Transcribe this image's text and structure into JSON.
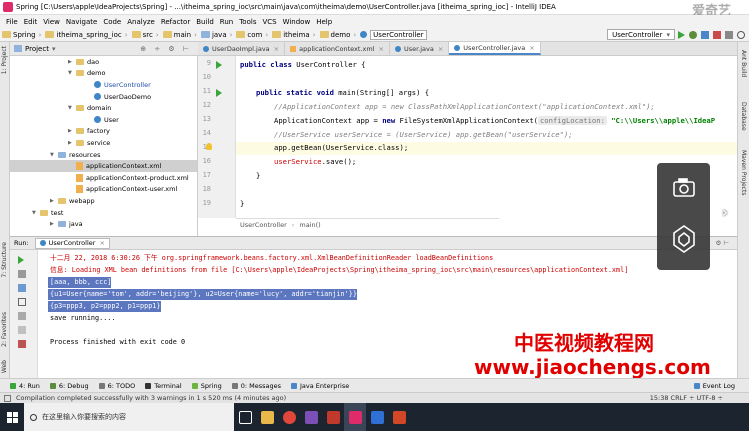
{
  "window_title": "Spring [C:\\Users\\apple\\IdeaProjects\\Spring] - ...\\itheima_spring_ioc\\src\\main\\java\\com\\itheima\\demo\\UserController.java [itheima_spring_ioc] - IntelliJ IDEA",
  "menu": [
    "File",
    "Edit",
    "View",
    "Navigate",
    "Code",
    "Analyze",
    "Refactor",
    "Build",
    "Run",
    "Tools",
    "VCS",
    "Window",
    "Help"
  ],
  "breadcrumbs": [
    "Spring",
    "itheima_spring_ioc",
    "src",
    "main",
    "java",
    "com",
    "itheima",
    "demo",
    "UserController"
  ],
  "run_config": "UserController",
  "project_panel": {
    "title": "Project"
  },
  "tree": [
    {
      "label": "dao",
      "depth": 6,
      "kind": "folder",
      "expanded": false
    },
    {
      "label": "demo",
      "depth": 6,
      "kind": "folder",
      "expanded": true
    },
    {
      "label": "UserController",
      "depth": 8,
      "kind": "class",
      "selected": false
    },
    {
      "label": "UserDaoDemo",
      "depth": 8,
      "kind": "class"
    },
    {
      "label": "domain",
      "depth": 6,
      "kind": "folder",
      "expanded": true
    },
    {
      "label": "User",
      "depth": 8,
      "kind": "class"
    },
    {
      "label": "factory",
      "depth": 6,
      "kind": "folder",
      "expanded": false
    },
    {
      "label": "service",
      "depth": 6,
      "kind": "folder",
      "expanded": false
    },
    {
      "label": "resources",
      "depth": 4,
      "kind": "folder",
      "expanded": true
    },
    {
      "label": "applicationContext.xml",
      "depth": 6,
      "kind": "xml",
      "selected": true
    },
    {
      "label": "applicationContext-product.xml",
      "depth": 6,
      "kind": "xml"
    },
    {
      "label": "applicationContext-user.xml",
      "depth": 6,
      "kind": "xml"
    },
    {
      "label": "webapp",
      "depth": 4,
      "kind": "folder",
      "expanded": false
    },
    {
      "label": "test",
      "depth": 2,
      "kind": "folder",
      "expanded": true
    },
    {
      "label": "java",
      "depth": 4,
      "kind": "folder",
      "expanded": false
    }
  ],
  "tabs": [
    {
      "label": "UserDaoImpl.java",
      "kind": "class",
      "active": false
    },
    {
      "label": "applicationContext.xml",
      "kind": "xml",
      "active": false
    },
    {
      "label": "User.java",
      "kind": "class",
      "active": false
    },
    {
      "label": "UserController.java",
      "kind": "class",
      "active": true
    }
  ],
  "line_numbers": [
    "9",
    "10",
    "11",
    "12",
    "13",
    "14",
    "15",
    "16",
    "17",
    "18",
    "19"
  ],
  "code": {
    "l9_kw": "public class",
    "l9_rest": " UserController {",
    "l11_kw": "public static void",
    "l11_rest": " main(String[] args) {",
    "l12": "//ApplicationContext app = new ClassPathXmlApplicationContext(\"applicationContext.xml\");",
    "l13_a": "ApplicationContext app = ",
    "l13_kw": "new",
    "l13_b": " FileSystemXmlApplicationContext(",
    "l13_hint": "configLocation:",
    "l13_str": " \"C:\\\\Users\\\\apple\\\\IdeaP",
    "l14": "//UserService userService = (UserService) app.getBean(\"userService\");",
    "l15": "app.getBean(UserService.class);",
    "l16_a": "userService",
    "l16_b": ".save();",
    "l17": "}",
    "l19": "}"
  },
  "code_breadcrumb": [
    "UserController",
    "main()"
  ],
  "run_panel": {
    "label": "Run:",
    "tab": "UserController"
  },
  "console": [
    {
      "text": "十二月 22, 2018 6:30:26 下午 org.springframework.beans.factory.xml.XmlBeanDefinitionReader loadBeanDefinitions",
      "style": "err"
    },
    {
      "text": "信息: Loading XML bean definitions from file [C:\\Users\\apple\\IdeaProjects\\Spring\\itheima_spring_ioc\\src\\main\\resources\\applicationContext.xml]",
      "style": "err"
    },
    {
      "text": "[aaa, bbb, ccc]",
      "style": "sel"
    },
    {
      "text": "{u1=User{name='tom', addr='beijing'}, u2=User{name='lucy', addr='tianjin'}}",
      "style": "sel"
    },
    {
      "text": "{p3=ppp3, p2=ppp2, p1=ppp1}",
      "style": "sel"
    },
    {
      "text": "save running....",
      "style": "normal"
    },
    {
      "text": "",
      "style": "normal"
    },
    {
      "text": "Process finished with exit code 0",
      "style": "normal"
    }
  ],
  "bottom_tabs": [
    "4: Run",
    "6: Debug",
    "6: TODO",
    "Terminal",
    "Spring",
    "0: Messages",
    "Java Enterprise"
  ],
  "event_log": "Event Log",
  "status_text": "Compilation completed successfully with 3 warnings in 1 s 520 ms (4 minutes ago)",
  "status_right": "15:38   CRLF ÷   UTF-8 ÷",
  "left_stripe": [
    "1: Project",
    "7: Structure",
    "2: Favorites",
    "Web"
  ],
  "right_stripe": [
    "Ant Build",
    "Database",
    "Maven Projects"
  ],
  "watermark_cn": "中医视频教程网",
  "watermark_url": "www.jiaochengs.com",
  "iqiyi": "爱奇艺",
  "taskbar_search": "在这里输入你要搜索的内容",
  "colors": {
    "accent": "#4a86c8",
    "selection": "#5c77c0",
    "error": "#c00000",
    "watermark": "#e00000"
  }
}
